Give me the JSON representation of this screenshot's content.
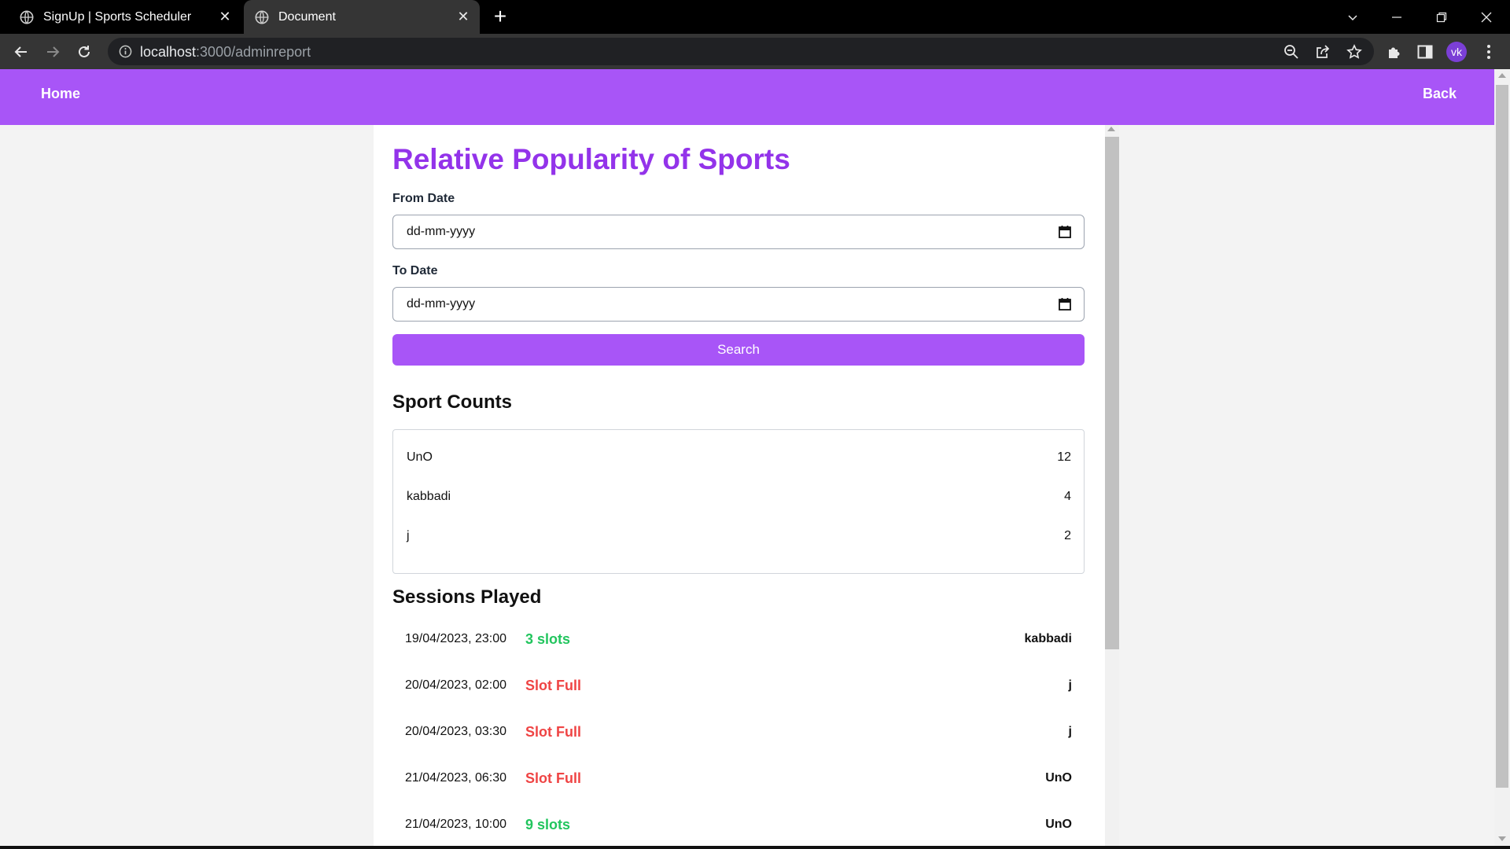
{
  "browser": {
    "tabs": [
      {
        "title": "SignUp | Sports Scheduler",
        "active": false
      },
      {
        "title": "Document",
        "active": true
      }
    ],
    "url_host": "localhost",
    "url_rest": ":3000/adminreport",
    "profile_initials": "vk"
  },
  "navbar": {
    "home_label": "Home",
    "back_label": "Back"
  },
  "page": {
    "title": "Relative Popularity of Sports",
    "from_label": "From Date",
    "from_placeholder": "dd-mm-yyyy",
    "to_label": "To Date",
    "to_placeholder": "dd-mm-yyyy",
    "search_label": "Search"
  },
  "sport_counts": {
    "title": "Sport Counts",
    "rows": [
      {
        "name": "UnO",
        "count": "12"
      },
      {
        "name": "kabbadi",
        "count": "4"
      },
      {
        "name": "j",
        "count": "2"
      }
    ]
  },
  "sessions": {
    "title": "Sessions Played",
    "rows": [
      {
        "datetime": "19/04/2023, 23:00",
        "slots": "3 slots",
        "status": "available",
        "sport": "kabbadi"
      },
      {
        "datetime": "20/04/2023, 02:00",
        "slots": "Slot Full",
        "status": "full",
        "sport": "j"
      },
      {
        "datetime": "20/04/2023, 03:30",
        "slots": "Slot Full",
        "status": "full",
        "sport": "j"
      },
      {
        "datetime": "21/04/2023, 06:30",
        "slots": "Slot Full",
        "status": "full",
        "sport": "UnO"
      },
      {
        "datetime": "21/04/2023, 10:00",
        "slots": "9 slots",
        "status": "available",
        "sport": "UnO"
      }
    ]
  },
  "colors": {
    "accent": "#a855f7",
    "title": "#9333ea",
    "available": "#22c55e",
    "full": "#ef4444"
  }
}
